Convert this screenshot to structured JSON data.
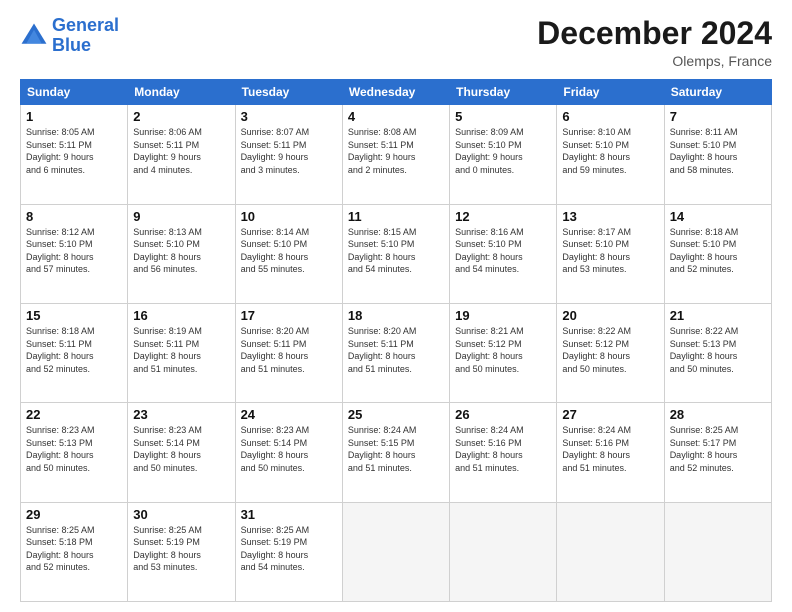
{
  "header": {
    "logo_line1": "General",
    "logo_line2": "Blue",
    "month_title": "December 2024",
    "location": "Olemps, France"
  },
  "weekdays": [
    "Sunday",
    "Monday",
    "Tuesday",
    "Wednesday",
    "Thursday",
    "Friday",
    "Saturday"
  ],
  "weeks": [
    [
      {
        "day": "1",
        "lines": [
          "Sunrise: 8:05 AM",
          "Sunset: 5:11 PM",
          "Daylight: 9 hours",
          "and 6 minutes."
        ]
      },
      {
        "day": "2",
        "lines": [
          "Sunrise: 8:06 AM",
          "Sunset: 5:11 PM",
          "Daylight: 9 hours",
          "and 4 minutes."
        ]
      },
      {
        "day": "3",
        "lines": [
          "Sunrise: 8:07 AM",
          "Sunset: 5:11 PM",
          "Daylight: 9 hours",
          "and 3 minutes."
        ]
      },
      {
        "day": "4",
        "lines": [
          "Sunrise: 8:08 AM",
          "Sunset: 5:11 PM",
          "Daylight: 9 hours",
          "and 2 minutes."
        ]
      },
      {
        "day": "5",
        "lines": [
          "Sunrise: 8:09 AM",
          "Sunset: 5:10 PM",
          "Daylight: 9 hours",
          "and 0 minutes."
        ]
      },
      {
        "day": "6",
        "lines": [
          "Sunrise: 8:10 AM",
          "Sunset: 5:10 PM",
          "Daylight: 8 hours",
          "and 59 minutes."
        ]
      },
      {
        "day": "7",
        "lines": [
          "Sunrise: 8:11 AM",
          "Sunset: 5:10 PM",
          "Daylight: 8 hours",
          "and 58 minutes."
        ]
      }
    ],
    [
      {
        "day": "8",
        "lines": [
          "Sunrise: 8:12 AM",
          "Sunset: 5:10 PM",
          "Daylight: 8 hours",
          "and 57 minutes."
        ]
      },
      {
        "day": "9",
        "lines": [
          "Sunrise: 8:13 AM",
          "Sunset: 5:10 PM",
          "Daylight: 8 hours",
          "and 56 minutes."
        ]
      },
      {
        "day": "10",
        "lines": [
          "Sunrise: 8:14 AM",
          "Sunset: 5:10 PM",
          "Daylight: 8 hours",
          "and 55 minutes."
        ]
      },
      {
        "day": "11",
        "lines": [
          "Sunrise: 8:15 AM",
          "Sunset: 5:10 PM",
          "Daylight: 8 hours",
          "and 54 minutes."
        ]
      },
      {
        "day": "12",
        "lines": [
          "Sunrise: 8:16 AM",
          "Sunset: 5:10 PM",
          "Daylight: 8 hours",
          "and 54 minutes."
        ]
      },
      {
        "day": "13",
        "lines": [
          "Sunrise: 8:17 AM",
          "Sunset: 5:10 PM",
          "Daylight: 8 hours",
          "and 53 minutes."
        ]
      },
      {
        "day": "14",
        "lines": [
          "Sunrise: 8:18 AM",
          "Sunset: 5:10 PM",
          "Daylight: 8 hours",
          "and 52 minutes."
        ]
      }
    ],
    [
      {
        "day": "15",
        "lines": [
          "Sunrise: 8:18 AM",
          "Sunset: 5:11 PM",
          "Daylight: 8 hours",
          "and 52 minutes."
        ]
      },
      {
        "day": "16",
        "lines": [
          "Sunrise: 8:19 AM",
          "Sunset: 5:11 PM",
          "Daylight: 8 hours",
          "and 51 minutes."
        ]
      },
      {
        "day": "17",
        "lines": [
          "Sunrise: 8:20 AM",
          "Sunset: 5:11 PM",
          "Daylight: 8 hours",
          "and 51 minutes."
        ]
      },
      {
        "day": "18",
        "lines": [
          "Sunrise: 8:20 AM",
          "Sunset: 5:11 PM",
          "Daylight: 8 hours",
          "and 51 minutes."
        ]
      },
      {
        "day": "19",
        "lines": [
          "Sunrise: 8:21 AM",
          "Sunset: 5:12 PM",
          "Daylight: 8 hours",
          "and 50 minutes."
        ]
      },
      {
        "day": "20",
        "lines": [
          "Sunrise: 8:22 AM",
          "Sunset: 5:12 PM",
          "Daylight: 8 hours",
          "and 50 minutes."
        ]
      },
      {
        "day": "21",
        "lines": [
          "Sunrise: 8:22 AM",
          "Sunset: 5:13 PM",
          "Daylight: 8 hours",
          "and 50 minutes."
        ]
      }
    ],
    [
      {
        "day": "22",
        "lines": [
          "Sunrise: 8:23 AM",
          "Sunset: 5:13 PM",
          "Daylight: 8 hours",
          "and 50 minutes."
        ]
      },
      {
        "day": "23",
        "lines": [
          "Sunrise: 8:23 AM",
          "Sunset: 5:14 PM",
          "Daylight: 8 hours",
          "and 50 minutes."
        ]
      },
      {
        "day": "24",
        "lines": [
          "Sunrise: 8:23 AM",
          "Sunset: 5:14 PM",
          "Daylight: 8 hours",
          "and 50 minutes."
        ]
      },
      {
        "day": "25",
        "lines": [
          "Sunrise: 8:24 AM",
          "Sunset: 5:15 PM",
          "Daylight: 8 hours",
          "and 51 minutes."
        ]
      },
      {
        "day": "26",
        "lines": [
          "Sunrise: 8:24 AM",
          "Sunset: 5:16 PM",
          "Daylight: 8 hours",
          "and 51 minutes."
        ]
      },
      {
        "day": "27",
        "lines": [
          "Sunrise: 8:24 AM",
          "Sunset: 5:16 PM",
          "Daylight: 8 hours",
          "and 51 minutes."
        ]
      },
      {
        "day": "28",
        "lines": [
          "Sunrise: 8:25 AM",
          "Sunset: 5:17 PM",
          "Daylight: 8 hours",
          "and 52 minutes."
        ]
      }
    ],
    [
      {
        "day": "29",
        "lines": [
          "Sunrise: 8:25 AM",
          "Sunset: 5:18 PM",
          "Daylight: 8 hours",
          "and 52 minutes."
        ]
      },
      {
        "day": "30",
        "lines": [
          "Sunrise: 8:25 AM",
          "Sunset: 5:19 PM",
          "Daylight: 8 hours",
          "and 53 minutes."
        ]
      },
      {
        "day": "31",
        "lines": [
          "Sunrise: 8:25 AM",
          "Sunset: 5:19 PM",
          "Daylight: 8 hours",
          "and 54 minutes."
        ]
      },
      null,
      null,
      null,
      null
    ]
  ]
}
